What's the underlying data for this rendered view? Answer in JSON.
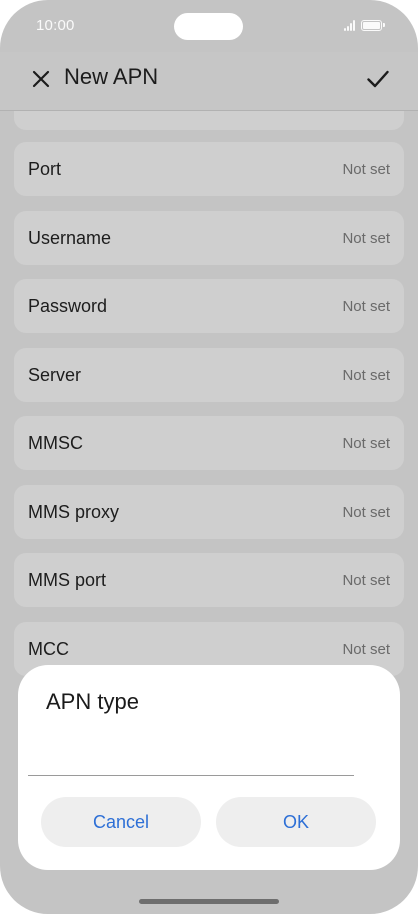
{
  "status_bar": {
    "time": "10:00"
  },
  "header": {
    "title": "New APN"
  },
  "list": {
    "items": [
      {
        "label": "Port",
        "value": "Not set"
      },
      {
        "label": "Username",
        "value": "Not set"
      },
      {
        "label": "Password",
        "value": "Not set"
      },
      {
        "label": "Server",
        "value": "Not set"
      },
      {
        "label": "MMSC",
        "value": "Not set"
      },
      {
        "label": "MMS proxy",
        "value": "Not set"
      },
      {
        "label": "MMS port",
        "value": "Not set"
      },
      {
        "label": "MCC",
        "value": "Not set"
      }
    ]
  },
  "dialog": {
    "title": "APN type",
    "input_value": "",
    "cancel_label": "Cancel",
    "ok_label": "OK"
  },
  "colors": {
    "accent": "#2d6fd6",
    "scrim_background": "#c4c4c4",
    "row_background": "#cfcfcf",
    "dialog_background": "#ffffff"
  },
  "icons": {
    "close": "close-icon",
    "confirm": "check-icon",
    "signal": "signal-icon",
    "battery": "battery-icon"
  }
}
